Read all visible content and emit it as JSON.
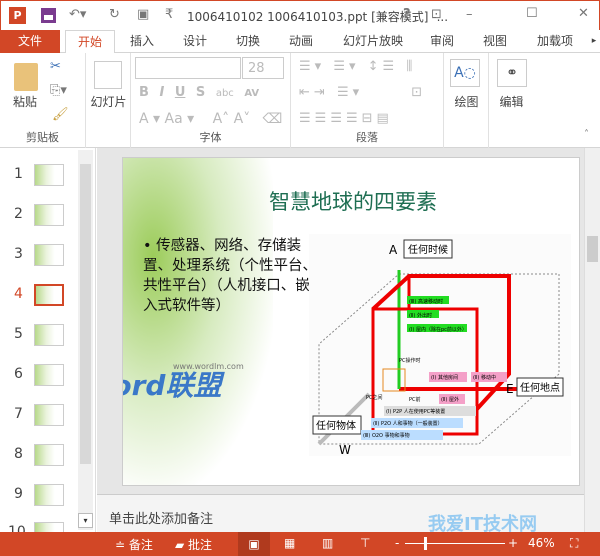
{
  "titlebar": {
    "title": "1006410102 1006410103.ppt [兼容模式] -...",
    "help": "?",
    "minimize": "–",
    "maximize": "☐",
    "close": "✕"
  },
  "tabs": [
    "文件",
    "开始",
    "插入",
    "设计",
    "切换",
    "动画",
    "幻灯片放映",
    "审阅",
    "视图",
    "加载项"
  ],
  "ribbon": {
    "clipboard": {
      "paste": "粘贴",
      "label": "剪贴板"
    },
    "slides": {
      "new_slide": "幻灯片"
    },
    "font": {
      "font_name": "",
      "font_size": "28",
      "label": "字体",
      "bold": "B",
      "italic": "I",
      "underline": "U",
      "shadow": "S",
      "strike": "abc",
      "spacing": "AV",
      "color": "A",
      "case": "Aa"
    },
    "paragraph": {
      "label": "段落"
    },
    "drawing": {
      "label": "绘图"
    },
    "editing": {
      "label": "编辑"
    }
  },
  "thumbnails": [
    {
      "n": "1"
    },
    {
      "n": "2"
    },
    {
      "n": "3"
    },
    {
      "n": "4",
      "selected": true
    },
    {
      "n": "5"
    },
    {
      "n": "6"
    },
    {
      "n": "7"
    },
    {
      "n": "8"
    },
    {
      "n": "9"
    },
    {
      "n": "10"
    }
  ],
  "slide": {
    "title": "智慧地球的四要素",
    "bullet": "传感器、网络、存储装置、处理系统（个性平台、共性平台）（人机接口、嵌入式软件等）",
    "watermark_url": "www.wordlm.com",
    "watermark_logo": "Word联盟",
    "diagram": {
      "axis_a": "A",
      "label_a": "任何时候",
      "axis_e": "E",
      "label_e": "任何地点",
      "axis_w": "W",
      "label_w": "任何物体",
      "green": [
        "(Ⅲ) 高速移动时",
        "(Ⅱ) 外出时",
        "(Ⅰ) 屋内（除在pc前以外）"
      ],
      "pink": [
        "(Ⅰ) 其他房间",
        "(Ⅱ) 移动中",
        "(Ⅱ) 屋外"
      ],
      "bottom": [
        "(Ⅰ) P2P  人在使用PC等装置",
        "(Ⅱ) P2O  人和事物（一般装置）",
        "(Ⅲ) O2O  事物和事物"
      ],
      "pc": [
        "PC操作时",
        "PC之间",
        "PC前"
      ]
    }
  },
  "notes": {
    "placeholder": "单击此处添加备注"
  },
  "status": {
    "notes": "备注",
    "comments": "批注",
    "zoom": "46%",
    "site_watermark": "我爱IT技术网"
  },
  "colors": {
    "accent": "#d24726",
    "title": "#1e6e52"
  }
}
